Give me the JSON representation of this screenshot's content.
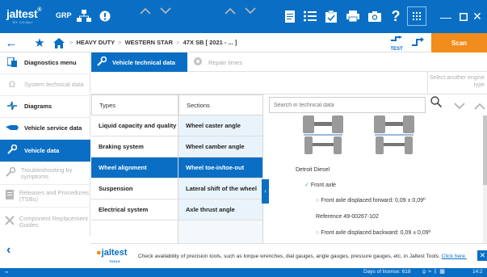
{
  "topbar": {
    "logo": "jaltest",
    "logo_sub": "BY COJALI",
    "product": "GRP",
    "alert_icon": "exclamation-icon",
    "help_label": "?",
    "window_controls": [
      "minimize",
      "maximize",
      "close"
    ]
  },
  "nav": {
    "breadcrumb": [
      "HEAVY DUTY",
      "WESTERN STAR",
      "47X SB [ 2021 - ... ]"
    ],
    "test_label": "TEST",
    "scan_label": "Scan"
  },
  "sidebar": {
    "items": [
      {
        "label": "Diagnostics menu",
        "icon": "diagnostics-icon",
        "state": "normal"
      },
      {
        "label": "System technical data",
        "icon": "omega-icon",
        "state": "disabled"
      },
      {
        "label": "Diagrams",
        "icon": "diagram-icon",
        "state": "normal"
      },
      {
        "label": "Vehicle service data",
        "icon": "service-icon",
        "state": "normal"
      },
      {
        "label": "Vehicle data",
        "icon": "wrench-icon",
        "state": "active"
      },
      {
        "label": "Troubleshooting by symptoms",
        "icon": "troubleshoot-icon",
        "state": "disabled"
      },
      {
        "label": "Releases and Procedures (TSBs)",
        "icon": "releases-icon",
        "state": "disabled"
      },
      {
        "label": "Component Replacement Guides",
        "icon": "component-icon",
        "state": "disabled"
      }
    ]
  },
  "tabs": [
    {
      "label": "Vehicle technical data",
      "active": true
    },
    {
      "label": "Repair times",
      "active": false
    }
  ],
  "select_type_label": "Select another engine type",
  "columns": {
    "types_header": "Types",
    "sections_header": "Sections"
  },
  "search": {
    "placeholder": "Search in technical data",
    "value": ""
  },
  "types": [
    {
      "label": "Liquid capacity and quality",
      "selected": false
    },
    {
      "label": "Braking system",
      "selected": false
    },
    {
      "label": "Wheel alignment",
      "selected": true
    },
    {
      "label": "Suspension",
      "selected": false
    },
    {
      "label": "Electrical system",
      "selected": false
    }
  ],
  "sections": [
    {
      "label": "Wheel caster angle",
      "selected": false
    },
    {
      "label": "Wheel camber angle",
      "selected": false
    },
    {
      "label": "Wheel toe-in/toe-out",
      "selected": true
    },
    {
      "label": "Lateral shift of the wheel",
      "selected": false
    },
    {
      "label": "Axle thrust angle",
      "selected": false
    }
  ],
  "detail": {
    "engine": "Detroit Diesel",
    "axle": "Front axle",
    "line1": "Front axle displaced forward: 0,09 ± 0,09º",
    "reference": "Reference 49-00267-102",
    "line2": "Front axle displaced backward: 0,09 ± 0,09º"
  },
  "tip": {
    "logo": "jaltest",
    "logo_sub": "TOOLS",
    "text": "Check availability of precision tools, such as torque wrenches, dial gauges, angle gauges, pressure gauges, etc. in Jaltest Tools.",
    "link": "Click here."
  },
  "status": {
    "license": "Days of license: 618",
    "time": "14:2"
  },
  "colors": {
    "primary": "#0a6fc4",
    "accent": "#f28c1c",
    "ok": "#3aa64a"
  }
}
